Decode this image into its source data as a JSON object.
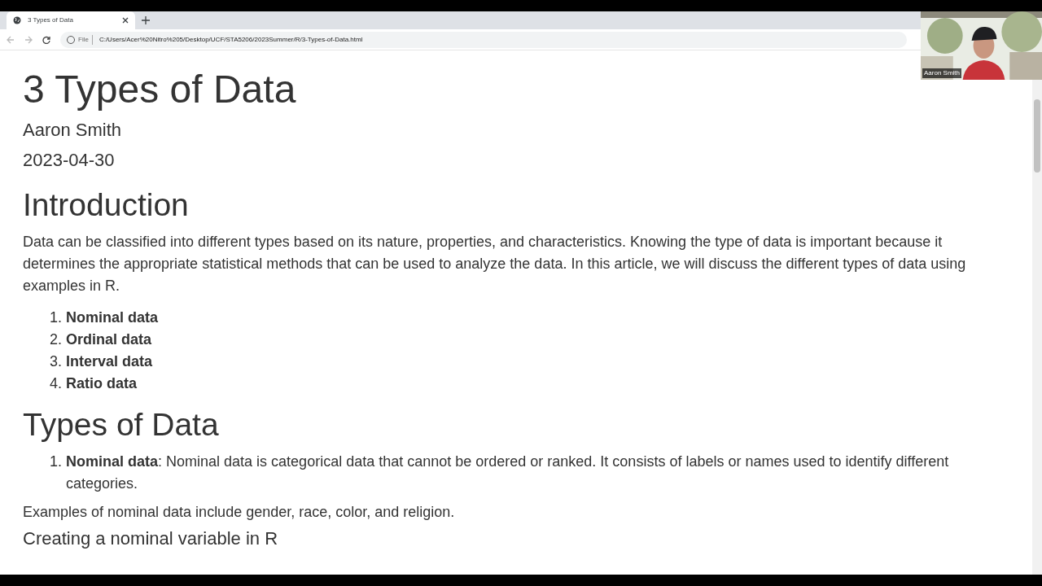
{
  "browser": {
    "tabs": [
      {
        "title": "3 Types of Data",
        "selected": true
      }
    ],
    "address": {
      "scheme": "File",
      "url": "C:/Users/Acer%20Nitro%205/Desktop/UCF/STA5206/2023Summer/R/3-Types-of-Data.html"
    }
  },
  "webcam": {
    "name": "Aaron Smith"
  },
  "document": {
    "title": "3 Types of Data",
    "author": "Aaron Smith",
    "date": "2023-04-30",
    "sections": [
      {
        "heading": "Introduction",
        "paragraph": "Data can be classified into different types based on its nature, properties, and characteristics. Knowing the type of data is important because it determines the appropriate statistical methods that can be used to analyze the data. In this article, we will discuss the different types of data using examples in R.",
        "list": [
          {
            "number": "1.",
            "text": "**Nominal data**"
          },
          {
            "number": "2.",
            "text": "**Ordinal data**"
          },
          {
            "number": "3.",
            "text": "**Interval data**"
          },
          {
            "number": "4.",
            "text": "**Ratio data**"
          }
        ]
      },
      {
        "heading": "Types of Data",
        "list": [
          {
            "number": "1.",
            "text": "**Nominal data**: Nominal data is categorical data that cannot be ordered or ranked. It consists of labels or names used to identify different categories."
          }
        ],
        "after": "Examples of nominal data include gender, race, color, and religion.",
        "subheading": "Creating a nominal variable in R"
      }
    ]
  }
}
